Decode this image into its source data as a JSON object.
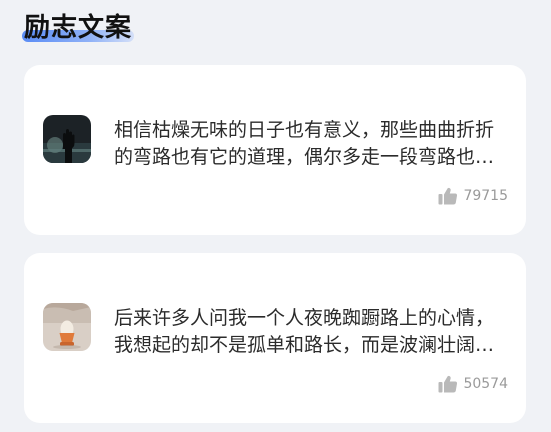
{
  "section": {
    "title": "励志文案"
  },
  "cards": [
    {
      "thumbnail_icon": "concert-hand-photo",
      "text": "相信枯燥无味的日子也有意义，那些曲曲折折的弯路也有它的道理，偶尔多走一段弯路也没关系",
      "likes": "79715"
    },
    {
      "thumbnail_icon": "egg-cup-photo",
      "text": "后来许多人问我一个人夜晚踟蹰路上的心情，我想起的却不是孤单和路长，而是波澜壮阔的海和天空中闪耀的星光",
      "likes": "50574"
    }
  ],
  "colors": {
    "background": "#f0f2f6",
    "card": "#ffffff",
    "title_underline": "#5a8cf5",
    "like_gray": "#9a9a9a"
  }
}
